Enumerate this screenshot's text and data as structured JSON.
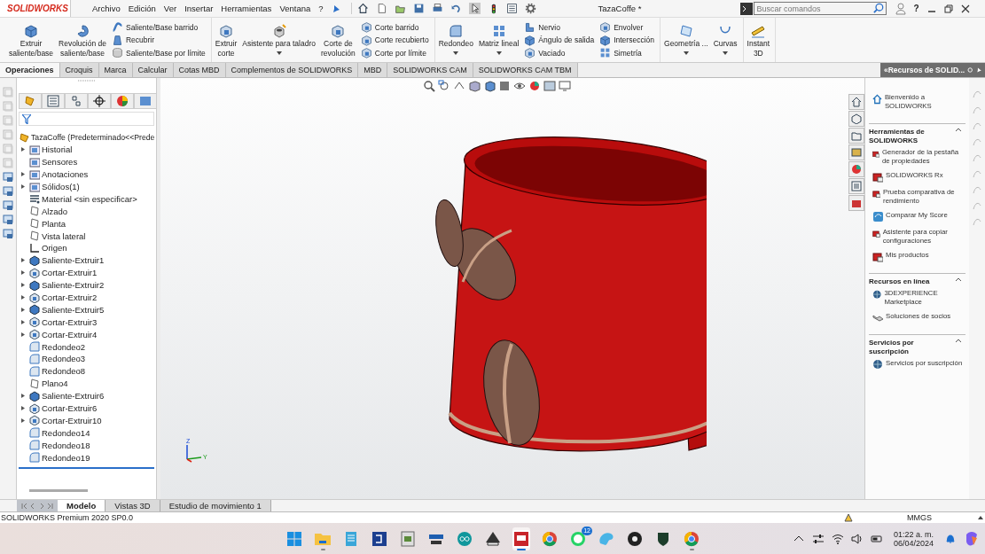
{
  "title_bar": {
    "logo": "SOLIDWORKS",
    "menu": [
      "Archivo",
      "Edición",
      "Ver",
      "Insertar",
      "Herramientas",
      "Ventana",
      "?"
    ],
    "document_title": "TazaCoffe *",
    "search": {
      "placeholder": "Buscar comandos"
    },
    "help": "?"
  },
  "ribbon": {
    "groups": [
      {
        "items": [
          {
            "kind": "large",
            "label": "Extruir\nsaliente/base"
          },
          {
            "kind": "large",
            "label": "Revolución de\nsaliente/base"
          },
          {
            "kind": "column",
            "items": [
              {
                "label": "Saliente/Base barrido"
              },
              {
                "label": "Recubrir"
              },
              {
                "label": "Saliente/Base por límite"
              }
            ]
          }
        ]
      },
      {
        "items": [
          {
            "kind": "large",
            "label": "Extruir\ncorte"
          },
          {
            "kind": "large",
            "label": "Asistente para taladro",
            "has_menu": true
          },
          {
            "kind": "large",
            "label": "Corte de\nrevolución"
          },
          {
            "kind": "column",
            "items": [
              {
                "label": "Corte barrido"
              },
              {
                "label": "Corte recubierto"
              },
              {
                "label": "Corte por límite"
              }
            ]
          }
        ]
      },
      {
        "items": [
          {
            "kind": "large",
            "label": "Redondeo",
            "has_menu": true
          },
          {
            "kind": "large",
            "label": "Matriz lineal",
            "has_menu": true
          },
          {
            "kind": "column",
            "items": [
              {
                "label": "Nervio"
              },
              {
                "label": "Ángulo de salida"
              },
              {
                "label": "Vaciado"
              }
            ]
          },
          {
            "kind": "column",
            "items": [
              {
                "label": "Envolver"
              },
              {
                "label": "Intersección"
              },
              {
                "label": "Simetría"
              }
            ]
          }
        ]
      },
      {
        "items": [
          {
            "kind": "large",
            "label": "Geometría ...",
            "has_menu": true
          },
          {
            "kind": "large",
            "label": "Curvas",
            "has_menu": true
          }
        ]
      },
      {
        "items": [
          {
            "kind": "large",
            "label": "Instant\n3D"
          }
        ]
      }
    ]
  },
  "command_tabs": [
    {
      "label": "Operaciones",
      "selected": true
    },
    {
      "label": "Croquis",
      "selected": false
    },
    {
      "label": "Marca",
      "selected": false
    },
    {
      "label": "Calcular",
      "selected": false
    },
    {
      "label": "Cotas MBD",
      "selected": false
    },
    {
      "label": "Complementos de SOLIDWORKS",
      "selected": false
    },
    {
      "label": "MBD",
      "selected": false
    },
    {
      "label": "SOLIDWORKS CAM",
      "selected": false
    },
    {
      "label": "SOLIDWORKS CAM TBM",
      "selected": false
    }
  ],
  "feature_tree": {
    "root": "TazaCoffe  (Predeterminado<<Prede",
    "items": [
      {
        "label": "Historial",
        "kind": "folder",
        "expanded": false
      },
      {
        "label": "Sensores",
        "kind": "folder"
      },
      {
        "label": "Anotaciones",
        "kind": "folder",
        "expanded": false
      },
      {
        "label": "Sólidos(1)",
        "kind": "folder",
        "expanded": false
      },
      {
        "label": "Material <sin especificar>",
        "kind": "material"
      },
      {
        "label": "Alzado",
        "kind": "plane"
      },
      {
        "label": "Planta",
        "kind": "plane"
      },
      {
        "label": "Vista lateral",
        "kind": "plane"
      },
      {
        "label": "Origen",
        "kind": "origin"
      },
      {
        "label": "Saliente-Extruir1",
        "kind": "boss",
        "expanded": false
      },
      {
        "label": "Cortar-Extruir1",
        "kind": "cut",
        "expanded": false
      },
      {
        "label": "Saliente-Extruir2",
        "kind": "boss",
        "expanded": false
      },
      {
        "label": "Cortar-Extruir2",
        "kind": "cut",
        "expanded": false
      },
      {
        "label": "Saliente-Extruir5",
        "kind": "boss",
        "expanded": false
      },
      {
        "label": "Cortar-Extruir3",
        "kind": "cut",
        "expanded": false
      },
      {
        "label": "Cortar-Extruir4",
        "kind": "cut",
        "expanded": false
      },
      {
        "label": "Redondeo2",
        "kind": "fillet"
      },
      {
        "label": "Redondeo3",
        "kind": "fillet"
      },
      {
        "label": "Redondeo8",
        "kind": "fillet"
      },
      {
        "label": "Plano4",
        "kind": "plane"
      },
      {
        "label": "Saliente-Extruir6",
        "kind": "boss",
        "expanded": false
      },
      {
        "label": "Cortar-Extruir6",
        "kind": "cut",
        "expanded": false
      },
      {
        "label": "Cortar-Extruir10",
        "kind": "cut",
        "expanded": false
      },
      {
        "label": "Redondeo14",
        "kind": "fillet"
      },
      {
        "label": "Redondeo18",
        "kind": "fillet"
      },
      {
        "label": "Redondeo19",
        "kind": "fillet"
      }
    ]
  },
  "viewport": {
    "triad_labels": [
      "Z",
      "Y"
    ]
  },
  "task_pane": {
    "title": "«Recursos de SOLID...",
    "welcome": {
      "label": "Bienvenido a SOLIDWORKS"
    },
    "sections": [
      {
        "heading": "Herramientas de SOLIDWORKS",
        "expanded": true,
        "items": [
          {
            "label": "Generador de la pestaña de propiedades",
            "kind": "tool"
          },
          {
            "label": "SOLIDWORKS Rx",
            "kind": "tool"
          },
          {
            "label": "Prueba comparativa de rendimiento",
            "kind": "tool"
          },
          {
            "label": "Comparar My Score",
            "kind": "score"
          },
          {
            "label": "Asistente para copiar configuraciones",
            "kind": "tool"
          },
          {
            "label": "Mis productos",
            "kind": "tool"
          }
        ]
      },
      {
        "heading": "Recursos en línea",
        "expanded": true,
        "items": [
          {
            "label": "3DEXPERIENCE Marketplace",
            "kind": "globe"
          },
          {
            "label": "Soluciones de socios",
            "kind": "handshake"
          }
        ]
      },
      {
        "heading": "Servicios por suscripción",
        "expanded": true,
        "items": [
          {
            "label": "Servicios por suscripción",
            "kind": "globe"
          }
        ]
      }
    ]
  },
  "bottom_tabs": [
    {
      "label": "Modelo",
      "selected": true
    },
    {
      "label": "Vistas 3D",
      "selected": false
    },
    {
      "label": "Estudio de movimiento 1",
      "selected": false
    }
  ],
  "status_bar": {
    "product": "SOLIDWORKS Premium 2020 SP0.0",
    "units": "MMGS"
  },
  "taskbar": {
    "apps": [
      {
        "kind": "start",
        "running": false
      },
      {
        "kind": "folder",
        "running": true
      },
      {
        "kind": "notepad",
        "running": false
      },
      {
        "kind": "square",
        "running": false
      },
      {
        "kind": "board",
        "running": false
      },
      {
        "kind": "festo",
        "running": false
      },
      {
        "kind": "arduino",
        "running": false
      },
      {
        "kind": "hat",
        "running": false
      },
      {
        "kind": "sw",
        "running": true,
        "active": true
      },
      {
        "kind": "chrome",
        "running": false
      },
      {
        "kind": "chat",
        "running": false,
        "badge": "12"
      },
      {
        "kind": "paint",
        "running": false
      },
      {
        "kind": "obs",
        "running": false
      },
      {
        "kind": "dark",
        "running": false
      },
      {
        "kind": "chrome",
        "running": true
      }
    ],
    "time": "01:22 a. m.",
    "date": "06/04/2024"
  }
}
